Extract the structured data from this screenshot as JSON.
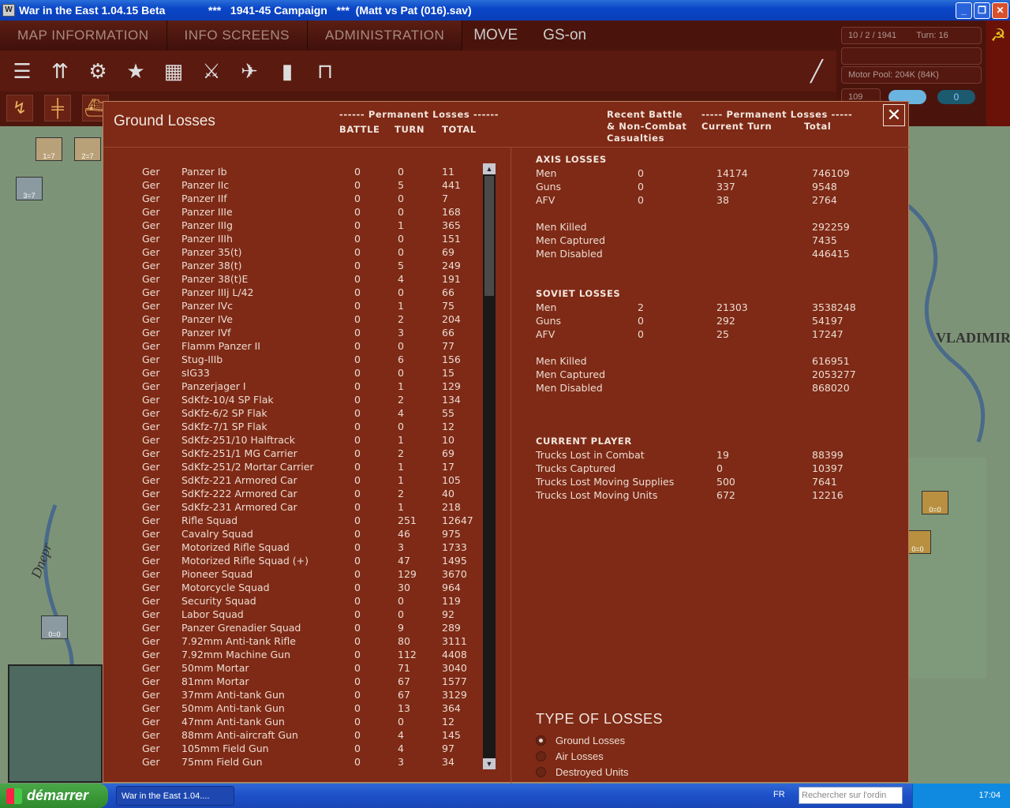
{
  "window": {
    "title": "War in the East 1.04.15 Beta              ***   1941-45 Campaign   ***  (Matt vs Pat (016).sav)",
    "min": "_",
    "max": "❐",
    "close": "✕"
  },
  "menu": {
    "tabs": [
      "MAP INFORMATION",
      "INFO SCREENS",
      "ADMINISTRATION"
    ],
    "mode1": "MOVE",
    "mode2": "GS-on"
  },
  "info": {
    "date": "10 / 2 / 1941",
    "turn": "Turn: 16",
    "motor_pool": "Motor Pool:  204K (84K)",
    "counter": "109",
    "toggle": "0"
  },
  "map": {
    "city": "VLADIMIR",
    "river": "Dnepr",
    "counters": [
      "1=7",
      "2=7",
      "3=7",
      "0=0",
      "0=0",
      "0=0"
    ]
  },
  "dialog": {
    "title": "Ground Losses",
    "close": "✕",
    "perm_header": "------ Permanent Losses ------",
    "col_battle": "BATTLE",
    "col_turn": "TURN",
    "col_total": "TOTAL",
    "recent_header": "Recent Battle\n& Non-Combat\nCasualties",
    "perm_header2": "----- Permanent Losses -----",
    "col_current": "Current Turn",
    "col_total2": "Total",
    "units": [
      [
        "Ger",
        "Panzer Ib",
        "0",
        "0",
        "11"
      ],
      [
        "Ger",
        "Panzer IIc",
        "0",
        "5",
        "441"
      ],
      [
        "Ger",
        "Panzer IIf",
        "0",
        "0",
        "7"
      ],
      [
        "Ger",
        "Panzer IIIe",
        "0",
        "0",
        "168"
      ],
      [
        "Ger",
        "Panzer IIIg",
        "0",
        "1",
        "365"
      ],
      [
        "Ger",
        "Panzer IIIh",
        "0",
        "0",
        "151"
      ],
      [
        "Ger",
        "Panzer 35(t)",
        "0",
        "0",
        "69"
      ],
      [
        "Ger",
        "Panzer 38(t)",
        "0",
        "5",
        "249"
      ],
      [
        "Ger",
        "Panzer 38(t)E",
        "0",
        "4",
        "191"
      ],
      [
        "Ger",
        "Panzer IIIj L/42",
        "0",
        "0",
        "66"
      ],
      [
        "Ger",
        "Panzer IVc",
        "0",
        "1",
        "75"
      ],
      [
        "Ger",
        "Panzer IVe",
        "0",
        "2",
        "204"
      ],
      [
        "Ger",
        "Panzer IVf",
        "0",
        "3",
        "66"
      ],
      [
        "Ger",
        "Flamm Panzer II",
        "0",
        "0",
        "77"
      ],
      [
        "Ger",
        "Stug-IIIb",
        "0",
        "6",
        "156"
      ],
      [
        "Ger",
        "sIG33",
        "0",
        "0",
        "15"
      ],
      [
        "Ger",
        "Panzerjager I",
        "0",
        "1",
        "129"
      ],
      [
        "Ger",
        "SdKfz-10/4 SP Flak",
        "0",
        "2",
        "134"
      ],
      [
        "Ger",
        "SdKfz-6/2 SP Flak",
        "0",
        "4",
        "55"
      ],
      [
        "Ger",
        "SdKfz-7/1 SP Flak",
        "0",
        "0",
        "12"
      ],
      [
        "Ger",
        "SdKfz-251/10 Halftrack",
        "0",
        "1",
        "10"
      ],
      [
        "Ger",
        "SdKfz-251/1 MG Carrier",
        "0",
        "2",
        "69"
      ],
      [
        "Ger",
        "SdKfz-251/2 Mortar Carrier",
        "0",
        "1",
        "17"
      ],
      [
        "Ger",
        "SdKfz-221 Armored Car",
        "0",
        "1",
        "105"
      ],
      [
        "Ger",
        "SdKfz-222 Armored Car",
        "0",
        "2",
        "40"
      ],
      [
        "Ger",
        "SdKfz-231 Armored Car",
        "0",
        "1",
        "218"
      ],
      [
        "Ger",
        "Rifle Squad",
        "0",
        "251",
        "12647"
      ],
      [
        "Ger",
        "Cavalry Squad",
        "0",
        "46",
        "975"
      ],
      [
        "Ger",
        "Motorized Rifle Squad",
        "0",
        "3",
        "1733"
      ],
      [
        "Ger",
        "Motorized Rifle Squad (+)",
        "0",
        "47",
        "1495"
      ],
      [
        "Ger",
        "Pioneer Squad",
        "0",
        "129",
        "3670"
      ],
      [
        "Ger",
        "Motorcycle Squad",
        "0",
        "30",
        "964"
      ],
      [
        "Ger",
        "Security Squad",
        "0",
        "0",
        "119"
      ],
      [
        "Ger",
        "Labor Squad",
        "0",
        "0",
        "92"
      ],
      [
        "Ger",
        "Panzer Grenadier Squad",
        "0",
        "9",
        "289"
      ],
      [
        "Ger",
        "7.92mm Anti-tank Rifle",
        "0",
        "80",
        "3111"
      ],
      [
        "Ger",
        "7.92mm Machine Gun",
        "0",
        "112",
        "4408"
      ],
      [
        "Ger",
        "50mm Mortar",
        "0",
        "71",
        "3040"
      ],
      [
        "Ger",
        "81mm Mortar",
        "0",
        "67",
        "1577"
      ],
      [
        "Ger",
        "37mm Anti-tank Gun",
        "0",
        "67",
        "3129"
      ],
      [
        "Ger",
        "50mm Anti-tank Gun",
        "0",
        "13",
        "364"
      ],
      [
        "Ger",
        "47mm Anti-tank Gun",
        "0",
        "0",
        "12"
      ],
      [
        "Ger",
        "88mm Anti-aircraft Gun",
        "0",
        "4",
        "145"
      ],
      [
        "Ger",
        "105mm Field Gun",
        "0",
        "4",
        "97"
      ],
      [
        "Ger",
        "75mm Field Gun",
        "0",
        "3",
        "34"
      ]
    ],
    "axis_title": "AXIS LOSSES",
    "axis_rows": [
      [
        "Men",
        "0",
        "14174",
        "746109"
      ],
      [
        "Guns",
        "0",
        "337",
        "9548"
      ],
      [
        "AFV",
        "0",
        "38",
        "2764"
      ]
    ],
    "axis_detail": [
      [
        "Men Killed",
        "292259"
      ],
      [
        "Men Captured",
        "7435"
      ],
      [
        "Men Disabled",
        "446415"
      ]
    ],
    "soviet_title": "SOVIET LOSSES",
    "soviet_rows": [
      [
        "Men",
        "2",
        "21303",
        "3538248"
      ],
      [
        "Guns",
        "0",
        "292",
        "54197"
      ],
      [
        "AFV",
        "0",
        "25",
        "17247"
      ]
    ],
    "soviet_detail": [
      [
        "Men Killed",
        "616951"
      ],
      [
        "Men Captured",
        "2053277"
      ],
      [
        "Men Disabled",
        "868020"
      ]
    ],
    "player_title": "CURRENT PLAYER",
    "player_rows": [
      [
        "Trucks Lost in Combat",
        "19",
        "88399"
      ],
      [
        "Trucks Captured",
        "0",
        "10397"
      ],
      [
        "Trucks Lost Moving Supplies",
        "500",
        "7641"
      ],
      [
        "Trucks Lost Moving Units",
        "672",
        "12216"
      ]
    ],
    "type_title": "TYPE OF LOSSES",
    "types": [
      "Ground Losses",
      "Air Losses",
      "Destroyed Units"
    ],
    "selected_type": "Ground Losses"
  },
  "taskbar": {
    "start": "démarrer",
    "task": "War in the East 1.04....",
    "lang": "FR",
    "search_placeholder": "Rechercher sur l'ordin",
    "clock": "17:04"
  }
}
